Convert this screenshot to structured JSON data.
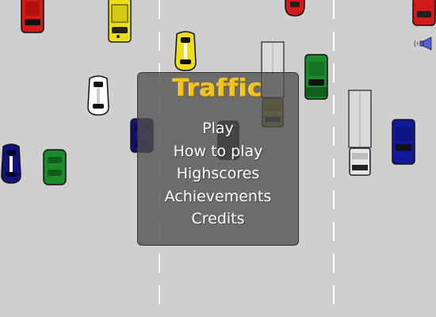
{
  "game": {
    "title": "Traffic",
    "menu": {
      "items": [
        {
          "id": "play",
          "label": "Play"
        },
        {
          "id": "how-to-play",
          "label": "How to play"
        },
        {
          "id": "highscores",
          "label": "Highscores"
        },
        {
          "id": "achievements",
          "label": "Achievements"
        },
        {
          "id": "credits",
          "label": "Credits"
        }
      ]
    },
    "sound_toggle": {
      "icon": "speaker-icon",
      "state": "on"
    }
  },
  "colors": {
    "road": "#cfcfcf",
    "lane_marking": "#ffffff",
    "title": "#f3c31a",
    "menu_text": "#ffffff",
    "sound_icon": "#5060d8"
  }
}
